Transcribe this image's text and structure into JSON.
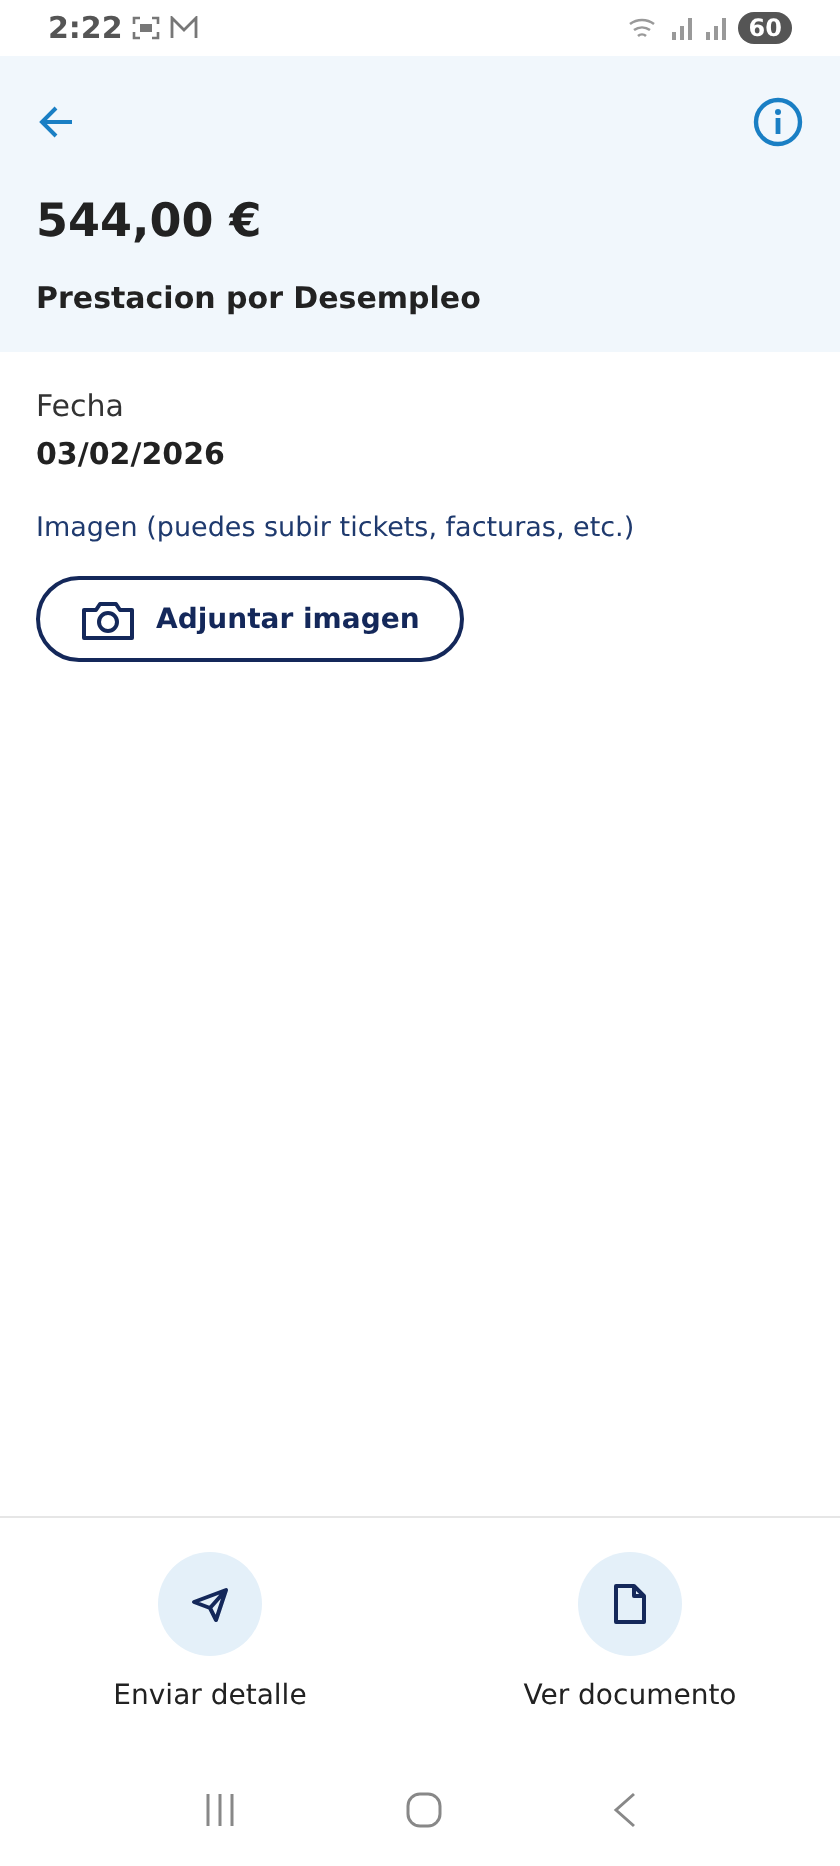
{
  "status_bar": {
    "time": "2:22",
    "battery": "60"
  },
  "header": {
    "amount": "544,00 €",
    "title": "Prestacion por Desempleo"
  },
  "fields": [
    {
      "label": "Fecha",
      "value": "03/02/2026"
    }
  ],
  "attachment": {
    "label": "Imagen (puedes subir tickets, facturas, etc.)",
    "button": "Adjuntar imagen"
  },
  "actions": [
    {
      "kind": "send",
      "label": "Enviar detalle"
    },
    {
      "kind": "document",
      "label": "Ver documento"
    }
  ]
}
